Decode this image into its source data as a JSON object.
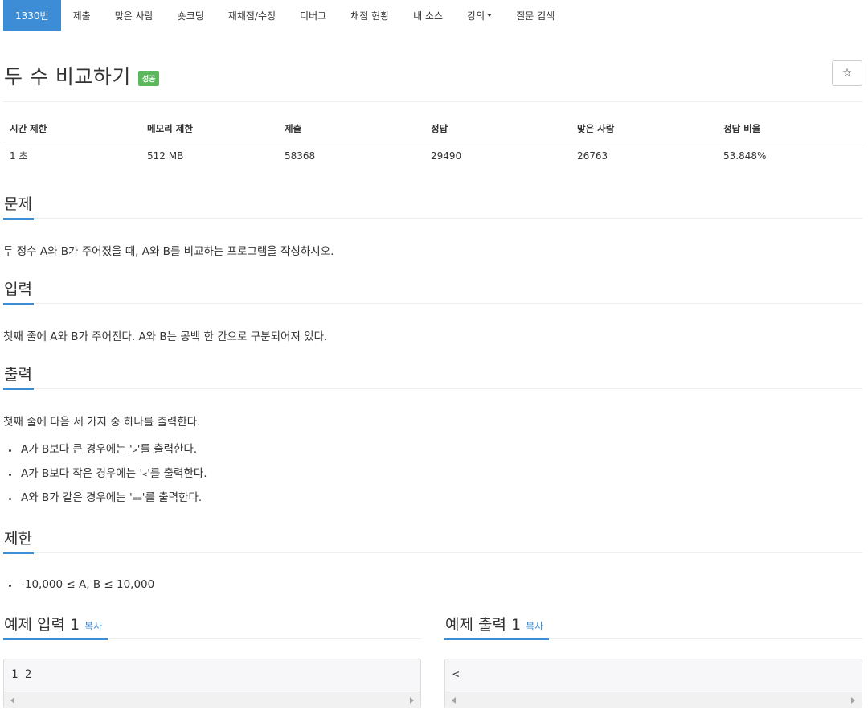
{
  "nav": {
    "items": [
      {
        "label": "1330번",
        "active": true
      },
      {
        "label": "제출"
      },
      {
        "label": "맞은 사람"
      },
      {
        "label": "숏코딩"
      },
      {
        "label": "재채점/수정"
      },
      {
        "label": "디버그"
      },
      {
        "label": "채점 현황"
      },
      {
        "label": "내 소스"
      },
      {
        "label": "강의",
        "dropdown": true
      },
      {
        "label": "질문 검색"
      }
    ]
  },
  "problem": {
    "title": "두 수 비교하기",
    "status_badge": "성공",
    "star_icon": "☆"
  },
  "info": {
    "headers": [
      "시간 제한",
      "메모리 제한",
      "제출",
      "정답",
      "맞은 사람",
      "정답 비율"
    ],
    "values": [
      "1 초",
      "512 MB",
      "58368",
      "29490",
      "26763",
      "53.848%"
    ]
  },
  "sections": {
    "problem_heading": "문제",
    "problem_text": "두 정수 A와 B가 주어졌을 때, A와 B를 비교하는 프로그램을 작성하시오.",
    "input_heading": "입력",
    "input_text": "첫째 줄에 A와 B가 주어진다. A와 B는 공백 한 칸으로 구분되어져 있다.",
    "output_heading": "출력",
    "output_text": "첫째 줄에 다음 세 가지 중 하나를 출력한다.",
    "output_items": [
      {
        "pre": "A가 B보다 큰 경우에는 '",
        "code": ">",
        "post": "'를 출력한다."
      },
      {
        "pre": "A가 B보다 작은 경우에는 '",
        "code": "<",
        "post": "'를 출력한다."
      },
      {
        "pre": "A와 B가 같은 경우에는 '",
        "code": "==",
        "post": "'를 출력한다."
      }
    ],
    "limit_heading": "제한",
    "limit_items": [
      "-10,000 ≤ A, B ≤ 10,000"
    ]
  },
  "samples": {
    "input_heading": "예제 입력 1",
    "output_heading": "예제 출력 1",
    "copy_label": "복사",
    "input_value": "1 2",
    "output_value": "<"
  },
  "colors": {
    "accent": "#3c8cd6",
    "success": "#5cb85c"
  }
}
